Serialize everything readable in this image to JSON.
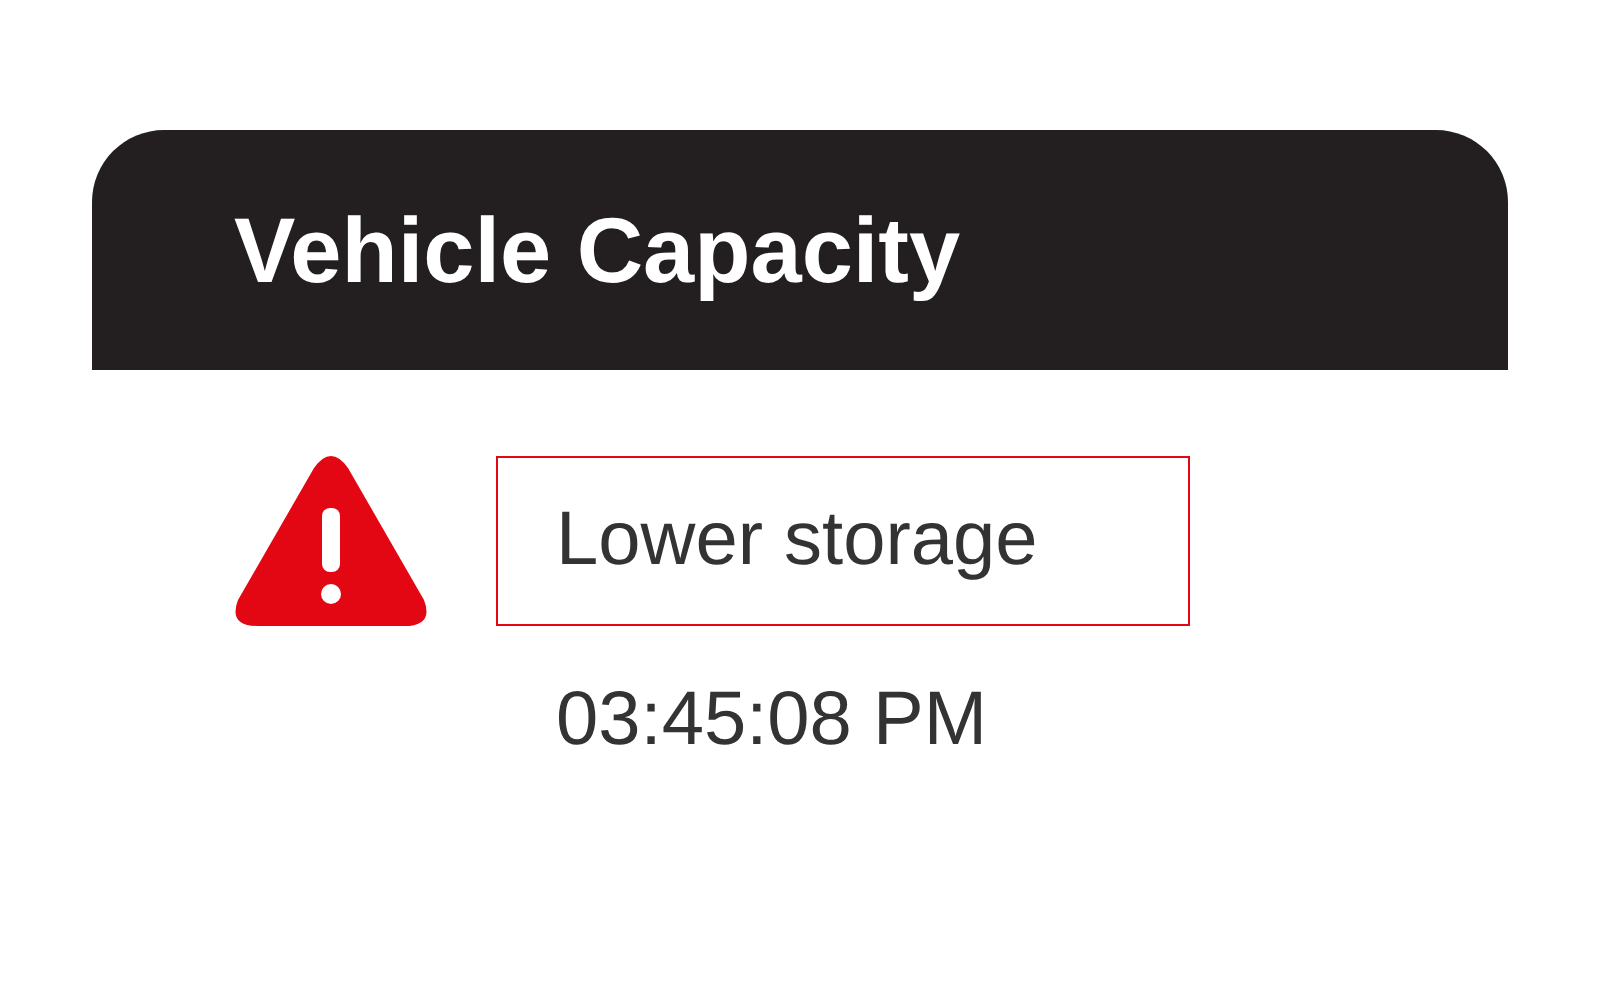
{
  "header": {
    "title": "Vehicle Capacity"
  },
  "alert": {
    "message": "Lower storage",
    "time": "03:45:08 PM"
  }
}
